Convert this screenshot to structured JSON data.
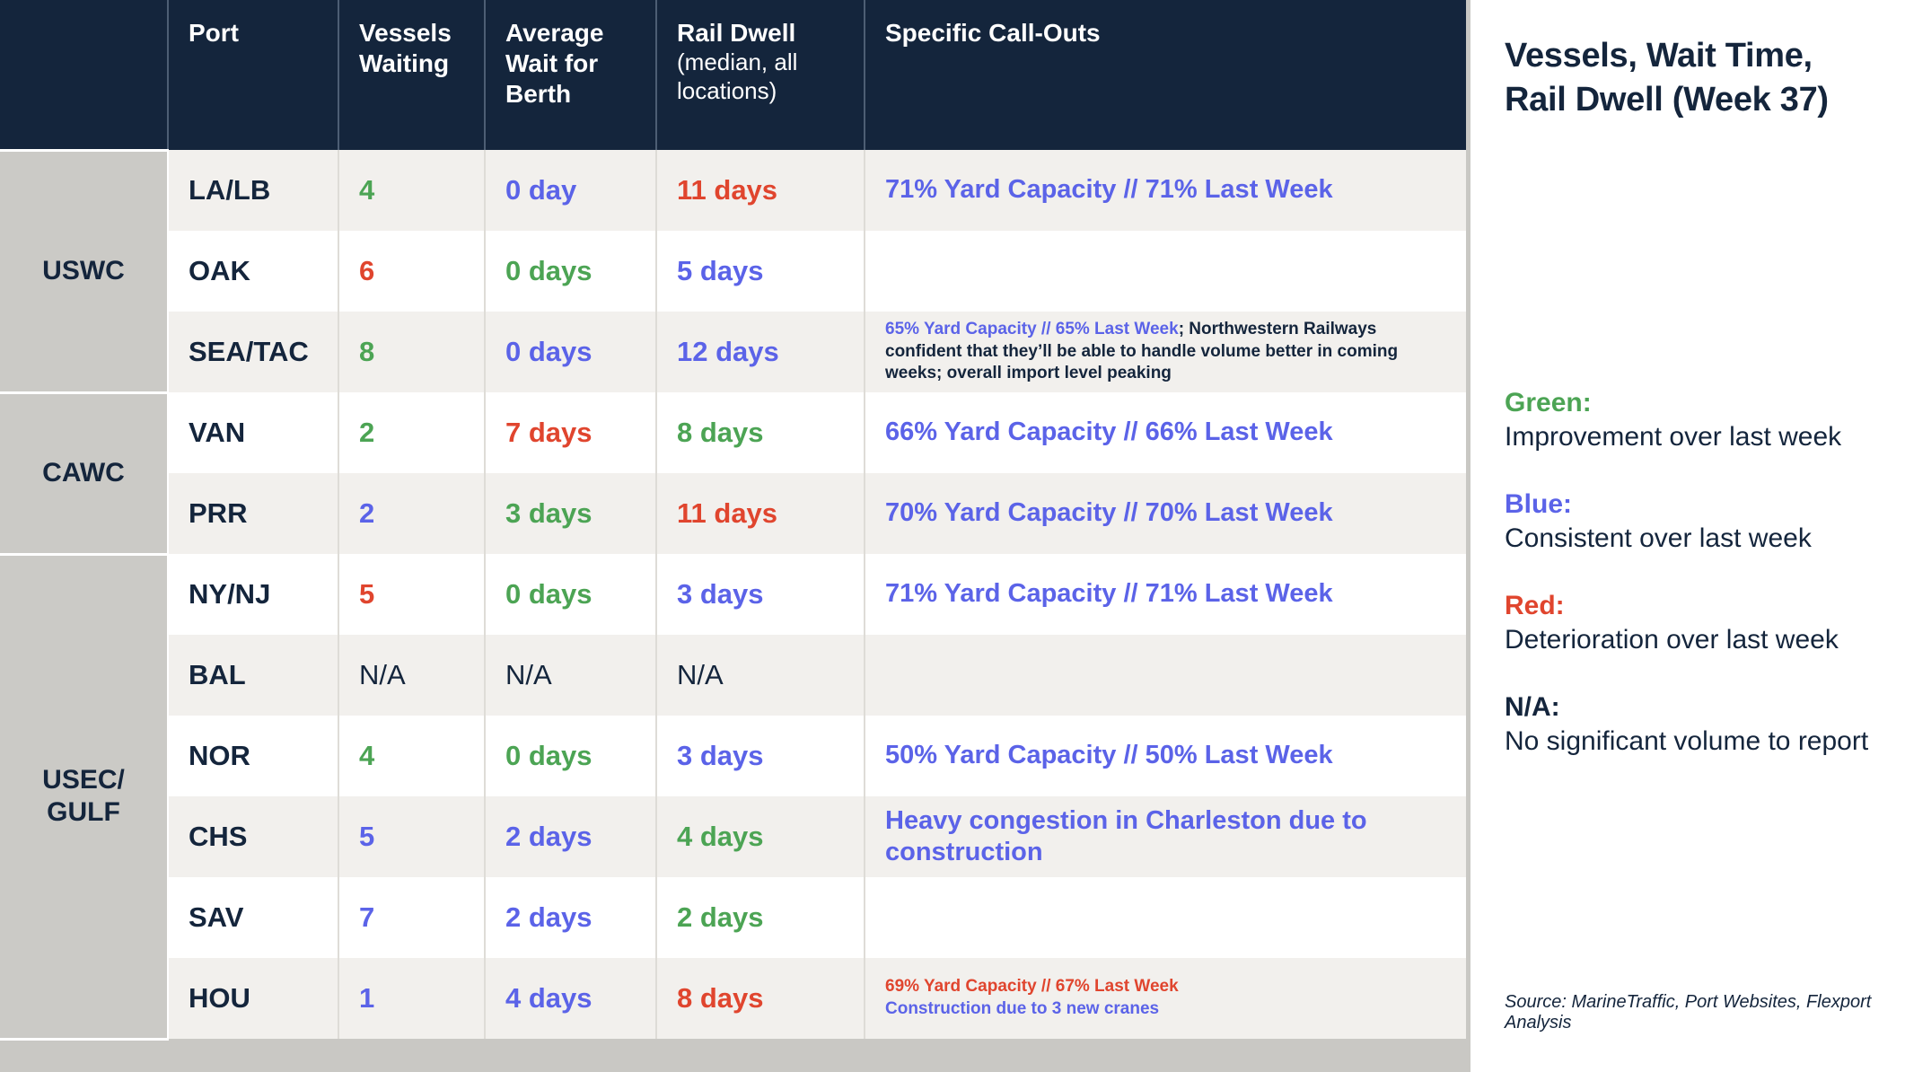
{
  "table": {
    "columns": [
      {
        "key": "group",
        "label": ""
      },
      {
        "key": "port",
        "label": "Port"
      },
      {
        "key": "vessels",
        "label": "Vessels Waiting"
      },
      {
        "key": "wait",
        "label": "Average Wait for Berth"
      },
      {
        "key": "rail",
        "label": "Rail Dwell",
        "sub": "(median, all locations)"
      },
      {
        "key": "callouts",
        "label": "Specific Call-Outs"
      }
    ],
    "header": {
      "port": "Port",
      "vessels": "Vessels Waiting",
      "wait": "Average Wait for Berth",
      "rail_main": "Rail Dwell",
      "rail_sub": "(median, all locations)",
      "callouts": "Specific Call-Outs"
    },
    "groups": [
      {
        "label": "USWC",
        "rows": 3
      },
      {
        "label": "CAWC",
        "rows": 2
      },
      {
        "label": "USEC/ GULF",
        "rows": 7
      }
    ],
    "rows": [
      {
        "group": "USWC",
        "port": "LA/LB",
        "vessels": {
          "text": "4",
          "color": "green"
        },
        "wait": {
          "text": "0 day",
          "color": "blue"
        },
        "rail": {
          "text": "11 days",
          "color": "red"
        },
        "callout": {
          "size": "large",
          "parts": [
            {
              "text": "71% Yard Capacity // 71% Last Week",
              "color": "blue"
            }
          ]
        }
      },
      {
        "group": "USWC",
        "port": "OAK",
        "vessels": {
          "text": "6",
          "color": "red"
        },
        "wait": {
          "text": "0 days",
          "color": "green"
        },
        "rail": {
          "text": "5 days",
          "color": "blue"
        },
        "callout": {
          "size": "large",
          "parts": []
        }
      },
      {
        "group": "USWC",
        "port": "SEA/TAC",
        "vessels": {
          "text": "8",
          "color": "green"
        },
        "wait": {
          "text": "0 days",
          "color": "blue"
        },
        "rail": {
          "text": "12 days",
          "color": "blue"
        },
        "callout": {
          "size": "small",
          "parts": [
            {
              "text": "65% Yard Capacity // 65% Last Week",
              "color": "blue"
            },
            {
              "text": "; Northwestern Railways confident that they’ll be able to handle volume better in coming weeks; overall import level peaking",
              "color": "navy"
            }
          ]
        }
      },
      {
        "group": "CAWC",
        "port": "VAN",
        "vessels": {
          "text": "2",
          "color": "green"
        },
        "wait": {
          "text": "7 days",
          "color": "red"
        },
        "rail": {
          "text": "8 days",
          "color": "green"
        },
        "callout": {
          "size": "large",
          "parts": [
            {
              "text": "66% Yard Capacity // 66% Last Week",
              "color": "blue"
            }
          ]
        }
      },
      {
        "group": "CAWC",
        "port": "PRR",
        "vessels": {
          "text": "2",
          "color": "blue"
        },
        "wait": {
          "text": "3 days",
          "color": "green"
        },
        "rail": {
          "text": "11 days",
          "color": "red"
        },
        "callout": {
          "size": "large",
          "parts": [
            {
              "text": "70% Yard Capacity // 70% Last Week",
              "color": "blue"
            }
          ]
        }
      },
      {
        "group": "USEC/ GULF",
        "port": "NY/NJ",
        "vessels": {
          "text": "5",
          "color": "red"
        },
        "wait": {
          "text": "0 days",
          "color": "green"
        },
        "rail": {
          "text": "3 days",
          "color": "blue"
        },
        "callout": {
          "size": "large",
          "parts": [
            {
              "text": "71% Yard Capacity // 71% Last Week",
              "color": "blue"
            }
          ]
        }
      },
      {
        "group": "USEC/ GULF",
        "port": "BAL",
        "vessels": {
          "text": "N/A",
          "color": "navy"
        },
        "wait": {
          "text": "N/A",
          "color": "navy"
        },
        "rail": {
          "text": "N/A",
          "color": "navy"
        },
        "callout": {
          "size": "large",
          "parts": []
        }
      },
      {
        "group": "USEC/ GULF",
        "port": "NOR",
        "vessels": {
          "text": "4",
          "color": "green"
        },
        "wait": {
          "text": "0 days",
          "color": "green"
        },
        "rail": {
          "text": "3 days",
          "color": "blue"
        },
        "callout": {
          "size": "large",
          "parts": [
            {
              "text": "50% Yard Capacity // 50% Last Week",
              "color": "blue"
            }
          ]
        }
      },
      {
        "group": "USEC/ GULF",
        "port": "CHS",
        "vessels": {
          "text": "5",
          "color": "blue"
        },
        "wait": {
          "text": "2 days",
          "color": "blue"
        },
        "rail": {
          "text": "4 days",
          "color": "green"
        },
        "callout": {
          "size": "large",
          "parts": [
            {
              "text": "Heavy congestion in Charleston due to construction",
              "color": "blue"
            }
          ]
        }
      },
      {
        "group": "USEC/ GULF",
        "port": "SAV",
        "vessels": {
          "text": "7",
          "color": "blue"
        },
        "wait": {
          "text": "2 days",
          "color": "blue"
        },
        "rail": {
          "text": "2 days",
          "color": "green"
        },
        "callout": {
          "size": "large",
          "parts": []
        }
      },
      {
        "group": "USEC/ GULF",
        "port": "HOU",
        "vessels": {
          "text": "1",
          "color": "blue"
        },
        "wait": {
          "text": "4 days",
          "color": "blue"
        },
        "rail": {
          "text": "8 days",
          "color": "red"
        },
        "callout": {
          "size": "small",
          "parts": [
            {
              "text": "69% Yard Capacity // 67% Last Week",
              "color": "red",
              "break_after": true
            },
            {
              "text": "Construction due to 3 new cranes",
              "color": "blue"
            }
          ]
        }
      }
    ]
  },
  "panel": {
    "title": "Vessels, Wait Time, Rail Dwell (Week 37)",
    "legend": [
      {
        "key": "Green:",
        "color": "green",
        "desc": "Improvement over last week"
      },
      {
        "key": "Blue:",
        "color": "blue",
        "desc": "Consistent over last week"
      },
      {
        "key": "Red:",
        "color": "red",
        "desc": "Deterioration over last week"
      },
      {
        "key": "N/A:",
        "color": "navy",
        "desc": "No significant volume to report"
      }
    ],
    "source": "Source: MarineTraffic, Port Websites, Flexport Analysis"
  },
  "colors": {
    "green": "#4ca454",
    "blue": "#5b63e8",
    "red": "#e0452e",
    "navy": "#14253c",
    "header_bg": "#14253c",
    "group_bg": "#cbcac6",
    "band_a": "#f2f0ed",
    "band_b": "#ffffff",
    "page_bg": "#c9c8c4"
  }
}
